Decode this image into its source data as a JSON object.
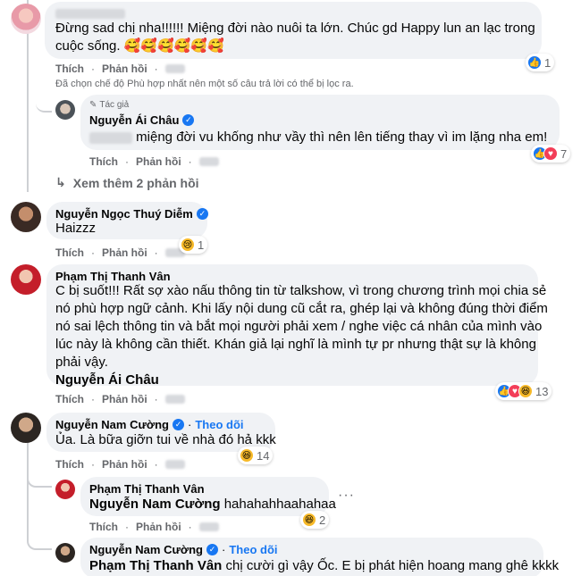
{
  "comment1": {
    "text_line1": "Đừng sad chị nha!!!!!! Miệng đời nào nuôi ta lớn. Chúc gd Happy lun an lạc trong",
    "text_line2": "cuộc sống. 🥰🥰🥰🥰🥰🥰",
    "like_label": "Thích",
    "reply_label": "Phản hồi",
    "reaction_count": "1"
  },
  "filter_notice": "Đã chọn chế độ Phù hợp nhất nên một số câu trả lời có thể bị lọc ra.",
  "reply1": {
    "author_badge": "Tác giả",
    "author": "Nguyễn Ái Châu",
    "text": "miệng đời vu khống như vầy thì nên lên tiếng thay vì im lặng nha em!",
    "like_label": "Thích",
    "reply_label": "Phản hồi",
    "reaction_count": "7"
  },
  "see_more_replies": "Xem thêm 2 phản hồi",
  "comment2": {
    "author": "Nguyễn Ngọc Thuý Diễm",
    "text": "Haizzz",
    "like_label": "Thích",
    "reply_label": "Phản hồi",
    "reaction_count": "1"
  },
  "comment3": {
    "author": "Phạm Thị Thanh Vân",
    "lines": [
      "C bị suốt!!! Rất sợ xào nấu thông tin từ talkshow, vì trong chương trình mọi chia sẻ",
      "nó phù hợp ngữ cảnh. Khi lấy nội dung cũ cắt ra, ghép lại và không đúng thời điểm",
      "nó sai lệch thông tin và bắt mọi người phải xem / nghe việc cá nhân của mình vào",
      "lúc này là không cần thiết. Khán giả lại nghĩ là mình tự pr nhưng thật sự là không",
      "phải vậy."
    ],
    "tagged": "Nguyễn Ái Châu",
    "like_label": "Thích",
    "reply_label": "Phản hồi",
    "reaction_count": "13"
  },
  "comment4": {
    "author": "Nguyễn Nam Cường",
    "follow_label": "Theo dõi",
    "text": "Ủa. Là bữa giỡn tui về nhà đó hả kkk",
    "like_label": "Thích",
    "reply_label": "Phản hồi",
    "reaction_count": "14"
  },
  "reply2": {
    "author": "Phạm Thị Thanh Vân",
    "tagged": "Nguyễn Nam Cường",
    "text": "hahahahhaahahaa",
    "like_label": "Thích",
    "reply_label": "Phản hồi",
    "reaction_count": "2",
    "more_icon": "···"
  },
  "reply3": {
    "author": "Nguyễn Nam Cường",
    "follow_label": "Theo dõi",
    "tagged": "Phạm Thị Thanh Vân",
    "text": "chị cười gì vậy Ốc. E bị phát hiện hoang mang ghê kkkk"
  },
  "icons": {
    "verified": "verified-badge-icon",
    "like": "like-reaction-icon",
    "love": "love-reaction-icon",
    "sad": "sad-reaction-icon",
    "haha": "haha-reaction-icon",
    "reply_arrow": "reply-arrow-icon",
    "pen": "pen-icon"
  },
  "colors": {
    "bubble": "#f0f2f5",
    "link_blue": "#1877f2",
    "meta_gray": "#65676b"
  }
}
